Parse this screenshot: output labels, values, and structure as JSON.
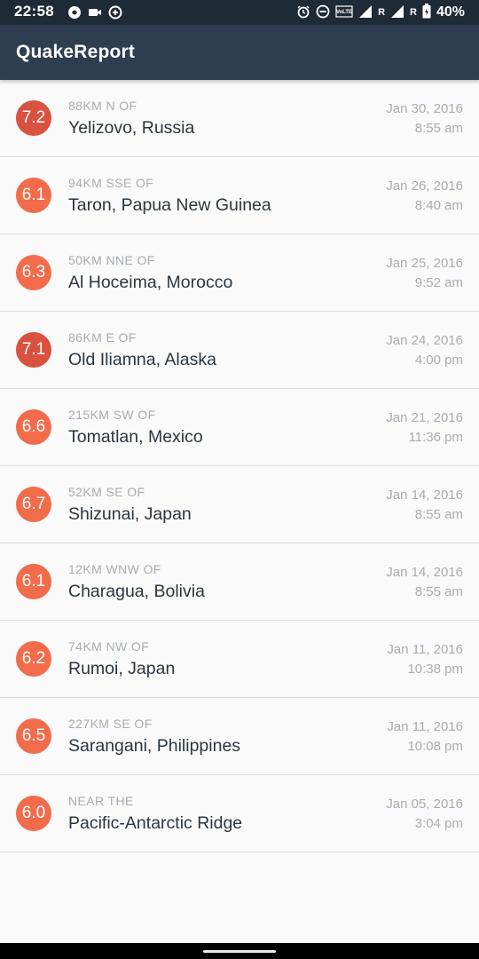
{
  "status_bar": {
    "time": "22:58",
    "battery": "40%",
    "network_labels": [
      "R",
      "R"
    ],
    "volte": "VoLTE",
    "icons": [
      "notification-icon",
      "camera-icon",
      "data-saver-icon",
      "alarm-icon",
      "dnd-icon",
      "volte-icon",
      "signal-icon",
      "battery-icon"
    ]
  },
  "app_bar": {
    "title": "QuakeReport"
  },
  "colors": {
    "mag_7": "#d9513f",
    "mag_6": "#f26c4c",
    "app_bar": "#2c3e50"
  },
  "earthquakes": [
    {
      "magnitude": "7.2",
      "offset": "88KM N OF",
      "place": "Yelizovo, Russia",
      "date": "Jan 30, 2016",
      "time": "8:55 am"
    },
    {
      "magnitude": "6.1",
      "offset": "94KM SSE OF",
      "place": "Taron, Papua New Guinea",
      "date": "Jan 26, 2016",
      "time": "8:40 am"
    },
    {
      "magnitude": "6.3",
      "offset": "50KM NNE OF",
      "place": "Al Hoceima, Morocco",
      "date": "Jan 25, 2016",
      "time": "9:52 am"
    },
    {
      "magnitude": "7.1",
      "offset": "86KM E OF",
      "place": "Old Iliamna, Alaska",
      "date": "Jan 24, 2016",
      "time": "4:00 pm"
    },
    {
      "magnitude": "6.6",
      "offset": "215KM SW OF",
      "place": "Tomatlan, Mexico",
      "date": "Jan 21, 2016",
      "time": "11:36 pm"
    },
    {
      "magnitude": "6.7",
      "offset": "52KM SE OF",
      "place": "Shizunai, Japan",
      "date": "Jan 14, 2016",
      "time": "8:55 am"
    },
    {
      "magnitude": "6.1",
      "offset": "12KM WNW OF",
      "place": "Charagua, Bolivia",
      "date": "Jan 14, 2016",
      "time": "8:55 am"
    },
    {
      "magnitude": "6.2",
      "offset": "74KM NW OF",
      "place": "Rumoi, Japan",
      "date": "Jan 11, 2016",
      "time": "10:38 pm"
    },
    {
      "magnitude": "6.5",
      "offset": "227KM SE OF",
      "place": "Sarangani, Philippines",
      "date": "Jan 11, 2016",
      "time": "10:08 pm"
    },
    {
      "magnitude": "6.0",
      "offset": "NEAR THE",
      "place": "Pacific-Antarctic Ridge",
      "date": "Jan 05, 2016",
      "time": "3:04 pm"
    }
  ]
}
